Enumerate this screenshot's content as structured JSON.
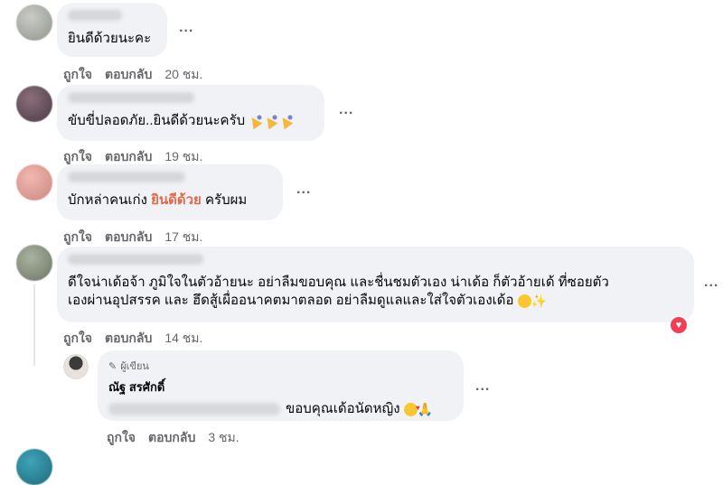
{
  "comments": [
    {
      "text": "ยินดีด้วยนะคะ",
      "like": "ถูกใจ",
      "reply": "ตอบกลับ",
      "time": "20 ชม."
    },
    {
      "text": "ขับขี่ปลอดภัย..ยินดีด้วยนะครับ",
      "like": "ถูกใจ",
      "reply": "ตอบกลับ",
      "time": "19 ชม."
    },
    {
      "text_before": "บักหล่าคนเก่ง ",
      "text_highlight": "ยินดีด้วย",
      "text_after": " ครับผม",
      "like": "ถูกใจ",
      "reply": "ตอบกลับ",
      "time": "17 ชม."
    },
    {
      "line1": "ดีใจน่าเด้อจ้า ภูมิใจในตัวอ้ายนะ อย่าลืมขอบคุณ และชื่นชมตัวเอง น่าเด้อ ก็ตัวอ้ายเด้ ที่ซอยตัว",
      "line2": "เองผ่านอุปสรรค และ ฮึดสู้เผื่ออนาคตมาตลอด อย่าลืมดูแลและใส่ใจตัวเองเด้อ",
      "like": "ถูกใจ",
      "reply": "ตอบกลับ",
      "time": "14 ชม."
    }
  ],
  "reply": {
    "author_badge": "ผู้เขียน",
    "author_name": "ณัฐ สรศักดิ์",
    "text": "ขอบคุณเด้อนัดหญิง",
    "like": "ถูกใจ",
    "reply": "ตอบกลับ",
    "time": "3 ชม."
  },
  "more_label": "...",
  "colors": {
    "highlight": "#e26a4c",
    "heart": "#f33e58",
    "bubble": "#f0f2f5"
  }
}
